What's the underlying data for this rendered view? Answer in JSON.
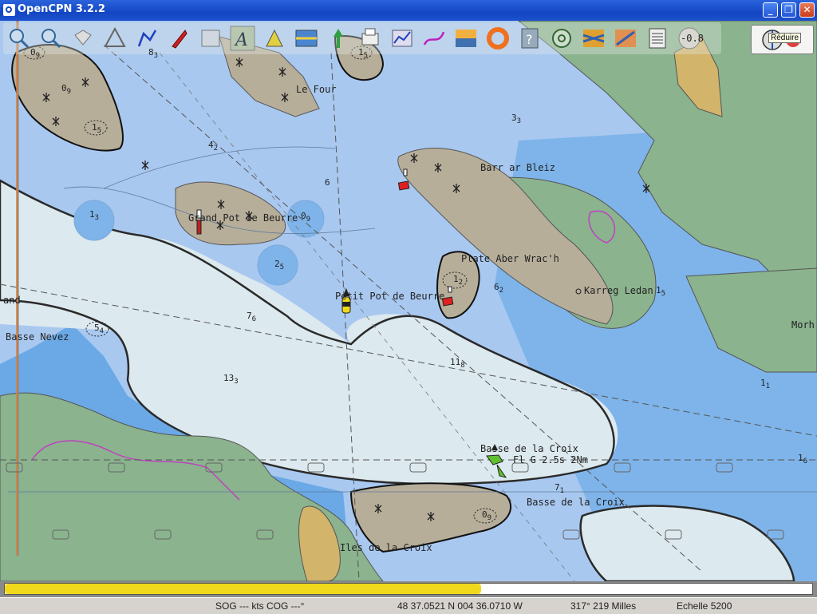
{
  "window": {
    "title": "OpenCPN 3.2.2"
  },
  "toolbar": {
    "tools": [
      "zoom-in-icon",
      "zoom-out-icon",
      "scale-in-icon",
      "scale-out-icon",
      "route-icon",
      "ship-icon",
      "chart-quilt-icon",
      "text-icon",
      "waypoint-icon",
      "tide-icon",
      "current-icon",
      "print-icon",
      "dashboard-icon",
      "track-icon",
      "color-scheme-icon",
      "mob-icon",
      "help-icon",
      "ais-icon",
      "grib-icon",
      "chart-icon",
      "log-icon",
      "compass-icon"
    ],
    "heading_value": "-0.8",
    "reduce_tooltip": "Réduire"
  },
  "chart": {
    "place_labels": {
      "le_four": "Le Four",
      "barr_ar_bleiz": "Barr ar Bleiz",
      "grand_pot_de_beurre": "Grand Pot de Beurre",
      "plate_aber_wrach": "Plate Aber Wrac'h",
      "karreg_ledan": "Karreg Ledan",
      "petit_pot_de_beurre": "Petit Pot de Beurre",
      "and": "and",
      "basse_nevez": "Basse Nevez",
      "morh": "Morh",
      "basse_de_la_croix_light": "Basse de la Croix",
      "light_character": "Fl G 2.5s 2Nm",
      "basse_de_la_croix": "Basse de la Croix",
      "iles_de_la_croix": "Iles de la Croix"
    },
    "soundings": [
      {
        "id": "d09a",
        "main": "0",
        "sub": "9"
      },
      {
        "id": "d83",
        "main": "8",
        "sub": "3"
      },
      {
        "id": "d09b",
        "main": "0",
        "sub": "9"
      },
      {
        "id": "d15a",
        "main": "1",
        "sub": "5"
      },
      {
        "id": "d33",
        "main": "3",
        "sub": "3"
      },
      {
        "id": "d42",
        "main": "4",
        "sub": "2"
      },
      {
        "id": "d6",
        "main": "6",
        "sub": ""
      },
      {
        "id": "d13a",
        "main": "1",
        "sub": "3"
      },
      {
        "id": "d09c",
        "main": "0",
        "sub": "9"
      },
      {
        "id": "d25",
        "main": "2",
        "sub": "5"
      },
      {
        "id": "d12",
        "main": "1",
        "sub": "2"
      },
      {
        "id": "d62",
        "main": "6",
        "sub": "2"
      },
      {
        "id": "d15b",
        "main": "1",
        "sub": "5"
      },
      {
        "id": "d76",
        "main": "7",
        "sub": "6"
      },
      {
        "id": "d54",
        "main": "5",
        "sub": "4"
      },
      {
        "id": "d118",
        "main": "11",
        "sub": "8"
      },
      {
        "id": "d133",
        "main": "13",
        "sub": "3"
      },
      {
        "id": "d11",
        "main": "1",
        "sub": "1"
      },
      {
        "id": "d16",
        "main": "1",
        "sub": "6"
      },
      {
        "id": "d71",
        "main": "7",
        "sub": "1"
      },
      {
        "id": "d09d",
        "main": "0",
        "sub": "9"
      },
      {
        "id": "d15c",
        "main": "1",
        "sub": "5"
      }
    ]
  },
  "progress": {
    "fraction": 0.59
  },
  "status": {
    "sog_cog": "SOG --- kts  COG ---°",
    "position": "48 37.0521 N   004 36.0710 W",
    "bearing_range": "317°  219 Milles",
    "scale": "Echelle 5200"
  },
  "colors": {
    "deep_water": "#a8c8f0",
    "medium_water": "#7eb4ea",
    "shallow_water": "#6aa8e6",
    "drying": "#dce9ee",
    "rock": "#b7ae9a",
    "land": "#8ab38e",
    "sand": "#d2b46a"
  }
}
